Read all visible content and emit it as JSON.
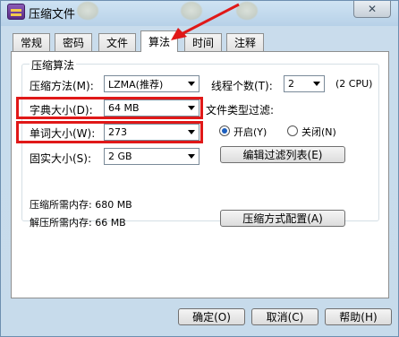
{
  "window": {
    "title": "压缩文件"
  },
  "tabs": [
    {
      "label": "常规"
    },
    {
      "label": "密码"
    },
    {
      "label": "文件"
    },
    {
      "label": "算法"
    },
    {
      "label": "时间"
    },
    {
      "label": "注释"
    }
  ],
  "algorithm": {
    "group_title": "压缩算法",
    "method": {
      "label": "压缩方法(M):",
      "value": "LZMA(推荐)"
    },
    "threads": {
      "label": "线程个数(T):",
      "value": "2",
      "cpu_note": "(2 CPU)"
    },
    "dictionary": {
      "label": "字典大小(D):",
      "value": "64 MB"
    },
    "word": {
      "label": "单词大小(W):",
      "value": "273"
    },
    "solid": {
      "label": "固实大小(S):",
      "value": "2 GB"
    },
    "filter": {
      "label": "文件类型过滤:",
      "on_label": "开启(Y)",
      "off_label": "关闭(N)",
      "selected": "on",
      "edit_button": "编辑过滤列表(E)"
    }
  },
  "memory": {
    "compress": "压缩所需内存: 680 MB",
    "decompress": "解压所需内存: 66 MB",
    "config_button": "压缩方式配置(A)"
  },
  "footer": {
    "ok": "确定(O)",
    "cancel": "取消(C)",
    "help": "帮助(H)"
  },
  "colors": {
    "highlight": "#e01818",
    "arrow": "#e01818"
  }
}
